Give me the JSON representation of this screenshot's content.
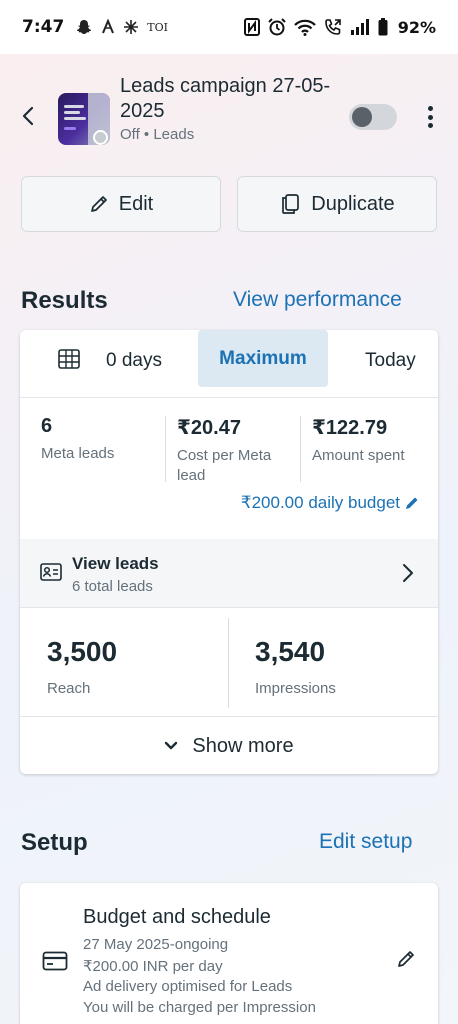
{
  "status_bar": {
    "time": "7:47",
    "left_icons": [
      "snapchat-icon",
      "news-icon",
      "star-icon",
      "toi-icon"
    ],
    "toi_label": "TOI",
    "right_icons": [
      "nfc-icon",
      "alarm-icon",
      "wifi-icon",
      "call-icon",
      "signal-icon",
      "battery-icon"
    ],
    "battery": "92%"
  },
  "campaign": {
    "title": "Leads campaign 27-05-2025",
    "status": "Off",
    "objective": "Leads",
    "toggle_on": false
  },
  "actions": {
    "edit_label": "Edit",
    "duplicate_label": "Duplicate"
  },
  "results": {
    "title": "Results",
    "link": "View performance",
    "tabs": {
      "days": "0 days",
      "maximum": "Maximum",
      "today": "Today",
      "selected": "Maximum"
    },
    "metrics": [
      {
        "value": "6",
        "label": "Meta leads"
      },
      {
        "value": "₹20.47",
        "label": "Cost per Meta lead"
      },
      {
        "value": "₹122.79",
        "label": "Amount spent"
      }
    ],
    "budget": "₹200.00 daily budget",
    "view_leads": {
      "title": "View leads",
      "subtitle": "6 total leads"
    },
    "reach": {
      "value": "3,500",
      "label": "Reach"
    },
    "impressions": {
      "value": "3,540",
      "label": "Impressions"
    },
    "show_more": "Show more"
  },
  "setup": {
    "title": "Setup",
    "link": "Edit setup",
    "budget_schedule": {
      "title": "Budget and schedule",
      "lines": [
        "27 May 2025-ongoing",
        "₹200.00 INR per day",
        "Ad delivery optimised for Leads",
        "You will be charged per Impression"
      ]
    }
  },
  "colors": {
    "accent": "#1c72b4",
    "text": "#1c2b33",
    "muted": "#65717b",
    "tab_selected_bg": "#dce9f3"
  }
}
